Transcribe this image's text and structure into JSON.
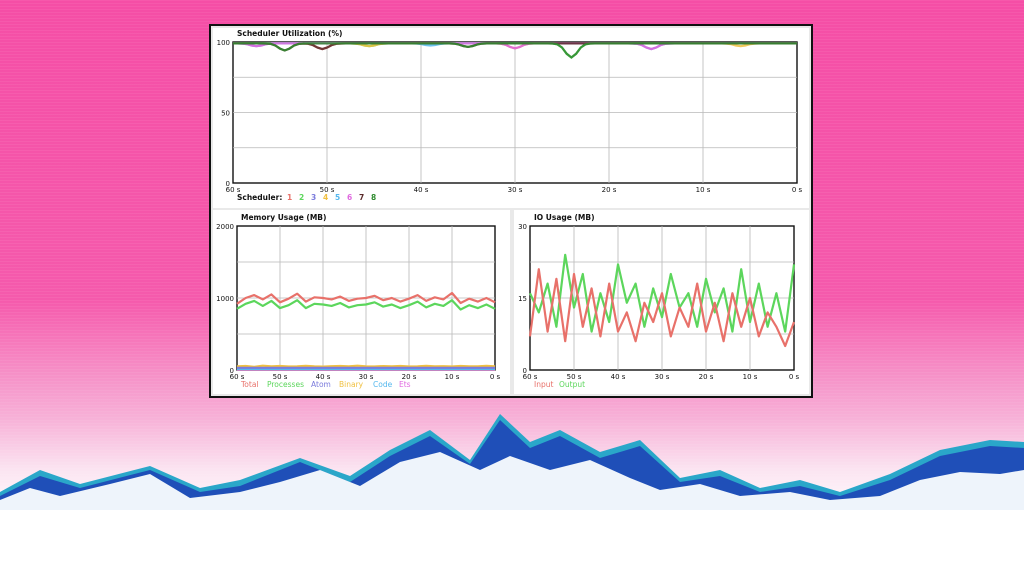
{
  "colors": {
    "c1": "#e8716a",
    "c2": "#5cd65c",
    "c3": "#7b7bdc",
    "c4": "#f0c040",
    "c5": "#55b8ee",
    "c6": "#e06ae0",
    "c7": "#5a2a2a",
    "c8": "#2e8b2e"
  },
  "chart_data": [
    {
      "type": "line",
      "title": "Scheduler Utilization (%)",
      "xlabel": "",
      "ylabel": "",
      "ylim": [
        0,
        100
      ],
      "xlim": [
        60,
        0
      ],
      "x_ticks": [
        "60 s",
        "50 s",
        "40 s",
        "30 s",
        "20 s",
        "10 s",
        "0 s"
      ],
      "y_ticks": [
        "0",
        "50",
        "100"
      ],
      "grid": true,
      "legend": {
        "prefix": "Scheduler:",
        "placement": "bottom-left",
        "entries": [
          "1",
          "2",
          "3",
          "4",
          "5",
          "6",
          "7",
          "8"
        ]
      },
      "baseline": 99,
      "dips": [
        {
          "x": 57.5,
          "value": 97,
          "series": [
            3,
            6
          ]
        },
        {
          "x": 54.5,
          "value": 94,
          "series": [
            7,
            8
          ]
        },
        {
          "x": 50.5,
          "value": 95,
          "series": [
            1,
            7
          ]
        },
        {
          "x": 45.5,
          "value": 97,
          "series": [
            2,
            4
          ]
        },
        {
          "x": 39.0,
          "value": 97.5,
          "series": [
            5
          ]
        },
        {
          "x": 35.0,
          "value": 96.5,
          "series": [
            7,
            8
          ]
        },
        {
          "x": 30.0,
          "value": 95.5,
          "series": [
            1,
            6
          ]
        },
        {
          "x": 24.0,
          "value": 89,
          "series": [
            2,
            8
          ]
        },
        {
          "x": 15.5,
          "value": 95,
          "series": [
            3,
            6
          ]
        },
        {
          "x": 6.0,
          "value": 97,
          "series": [
            4
          ]
        }
      ]
    },
    {
      "type": "line",
      "title": "Memory Usage (MB)",
      "ylim": [
        0,
        2000
      ],
      "xlim": [
        60,
        0
      ],
      "x_ticks": [
        "60 s",
        "50 s",
        "40 s",
        "30 s",
        "20 s",
        "10 s",
        "0 s"
      ],
      "y_ticks": [
        "0",
        "1000",
        "2000"
      ],
      "grid": true,
      "legend": {
        "placement": "bottom-left",
        "entries": [
          "Total",
          "Processes",
          "Atom",
          "Binary",
          "Code",
          "Ets"
        ]
      },
      "x": [
        60,
        58,
        56,
        54,
        52,
        50,
        48,
        46,
        44,
        42,
        40,
        38,
        36,
        34,
        32,
        30,
        28,
        26,
        24,
        22,
        20,
        18,
        16,
        14,
        12,
        10,
        8,
        6,
        4,
        2,
        0
      ],
      "series": [
        {
          "name": "Total",
          "values": [
            920,
            1000,
            1040,
            980,
            1050,
            940,
            990,
            1060,
            950,
            1010,
            1000,
            980,
            1020,
            960,
            990,
            1000,
            1030,
            970,
            1000,
            950,
            990,
            1040,
            960,
            1010,
            980,
            1070,
            930,
            990,
            950,
            1000,
            940
          ]
        },
        {
          "name": "Processes",
          "values": [
            850,
            920,
            960,
            890,
            960,
            860,
            900,
            970,
            860,
            920,
            910,
            890,
            930,
            870,
            900,
            910,
            940,
            880,
            910,
            860,
            900,
            950,
            870,
            920,
            890,
            970,
            840,
            900,
            860,
            910,
            850
          ]
        },
        {
          "name": "Atom",
          "values": [
            30,
            30,
            30,
            30,
            30,
            30,
            30,
            30,
            30,
            30,
            30,
            30,
            30,
            30,
            30,
            30,
            30,
            30,
            30,
            30,
            30,
            30,
            30,
            30,
            30,
            30,
            30,
            30,
            30,
            30,
            30
          ]
        },
        {
          "name": "Binary",
          "values": [
            50,
            55,
            45,
            60,
            50,
            55,
            48,
            52,
            58,
            50,
            47,
            53,
            55,
            50,
            60,
            52,
            48,
            54,
            50,
            56,
            49,
            51,
            57,
            50,
            53,
            48,
            55,
            50,
            52,
            58,
            50
          ]
        },
        {
          "name": "Code",
          "values": [
            15,
            15,
            15,
            15,
            15,
            15,
            15,
            15,
            15,
            15,
            15,
            15,
            15,
            15,
            15,
            15,
            15,
            15,
            15,
            15,
            15,
            15,
            15,
            15,
            15,
            15,
            15,
            15,
            15,
            15,
            15
          ]
        },
        {
          "name": "Ets",
          "values": [
            8,
            8,
            8,
            8,
            8,
            8,
            8,
            8,
            8,
            8,
            8,
            8,
            8,
            8,
            8,
            8,
            8,
            8,
            8,
            8,
            8,
            8,
            8,
            8,
            8,
            8,
            8,
            8,
            8,
            8,
            8
          ]
        }
      ]
    },
    {
      "type": "line",
      "title": "IO Usage (MB)",
      "ylim": [
        0,
        30
      ],
      "xlim": [
        60,
        0
      ],
      "x_ticks": [
        "60 s",
        "50 s",
        "40 s",
        "30 s",
        "20 s",
        "10 s",
        "0 s"
      ],
      "y_ticks": [
        "0",
        "15",
        "30"
      ],
      "grid": true,
      "legend": {
        "placement": "bottom-left",
        "entries": [
          "Input",
          "Output"
        ]
      },
      "x": [
        60,
        58,
        56,
        54,
        52,
        50,
        48,
        46,
        44,
        42,
        40,
        38,
        36,
        34,
        32,
        30,
        28,
        26,
        24,
        22,
        20,
        18,
        16,
        14,
        12,
        10,
        8,
        6,
        4,
        2,
        0
      ],
      "series": [
        {
          "name": "Input",
          "values": [
            7,
            21,
            8,
            19,
            6,
            20,
            9,
            17,
            7,
            18,
            8,
            12,
            6,
            14,
            10,
            16,
            7,
            13,
            9,
            18,
            8,
            14,
            6,
            16,
            9,
            15,
            7,
            12,
            9,
            5,
            10
          ]
        },
        {
          "name": "Output",
          "values": [
            16,
            12,
            18,
            9,
            24,
            13,
            20,
            8,
            16,
            10,
            22,
            14,
            18,
            9,
            17,
            11,
            20,
            13,
            16,
            9,
            19,
            12,
            17,
            8,
            21,
            10,
            18,
            9,
            16,
            8,
            22
          ]
        }
      ]
    }
  ]
}
